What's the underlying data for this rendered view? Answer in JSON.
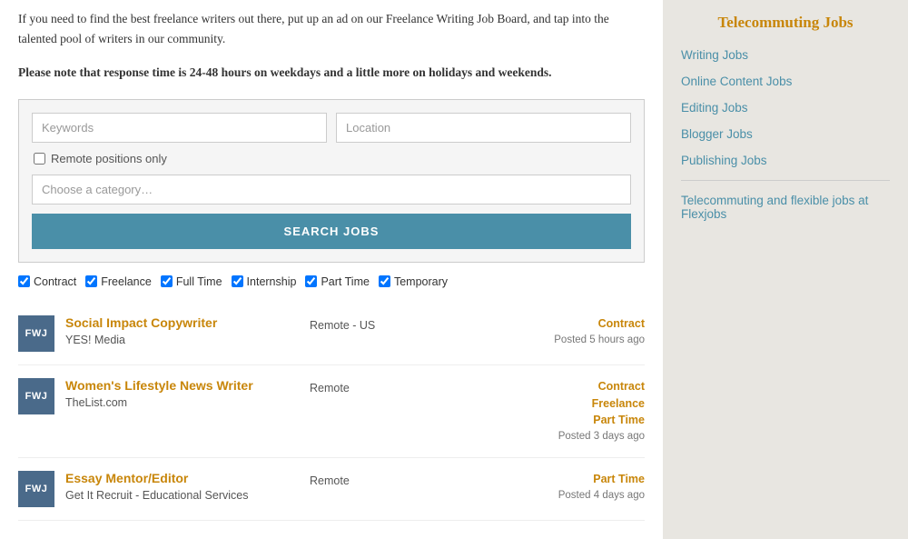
{
  "intro": {
    "text": "If you need to find the best freelance writers out there, put up an ad on our Freelance Writing Job Board, and tap into the talented pool of writers in our community.",
    "notice": "Please note that response time is 24-48 hours on weekdays and a little more on holidays and weekends."
  },
  "search": {
    "keywords_placeholder": "Keywords",
    "location_placeholder": "Location",
    "remote_label": "Remote positions only",
    "category_placeholder": "Choose a category…",
    "button_label": "SEARCH JOBS"
  },
  "filters": [
    {
      "label": "Contract",
      "checked": true
    },
    {
      "label": "Freelance",
      "checked": true
    },
    {
      "label": "Full Time",
      "checked": true
    },
    {
      "label": "Internship",
      "checked": true
    },
    {
      "label": "Part Time",
      "checked": true
    },
    {
      "label": "Temporary",
      "checked": true
    }
  ],
  "jobs": [
    {
      "logo_text": "FWJ",
      "title": "Social Impact Copywriter",
      "company": "YES! Media",
      "location": "Remote - US",
      "types": [
        "Contract"
      ],
      "posted": "Posted 5 hours ago"
    },
    {
      "logo_text": "FWJ",
      "title": "Women's Lifestyle News Writer",
      "company": "TheList.com",
      "location": "Remote",
      "types": [
        "Contract",
        "Freelance",
        "Part Time"
      ],
      "posted": "Posted 3 days ago"
    },
    {
      "logo_text": "FWJ",
      "title": "Essay Mentor/Editor",
      "company": "Get It Recruit - Educational Services",
      "location": "Remote",
      "types": [
        "Part Time"
      ],
      "posted": "Posted 4 days ago"
    }
  ],
  "sidebar": {
    "title": "Telecommuting Jobs",
    "links": [
      "Writing Jobs",
      "Online Content Jobs",
      "Editing Jobs",
      "Blogger Jobs",
      "Publishing Jobs",
      "Telecommuting and flexible jobs at Flexjobs"
    ]
  }
}
